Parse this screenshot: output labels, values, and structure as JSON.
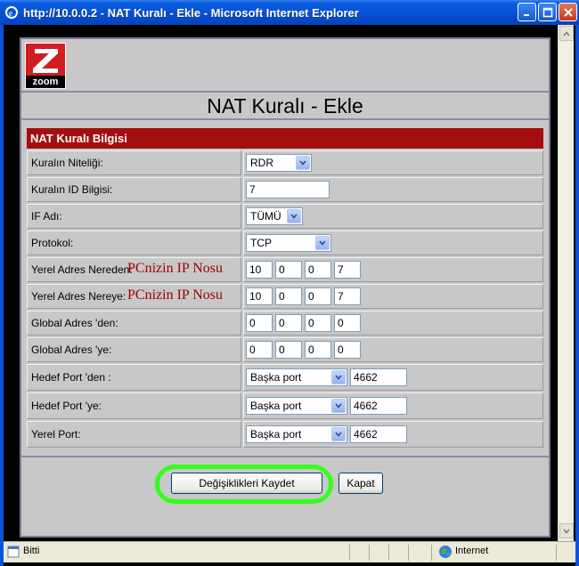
{
  "window": {
    "title": "http://10.0.0.2 - NAT Kuralı - Ekle - Microsoft Internet Explorer"
  },
  "logo": {
    "text": "zoom"
  },
  "page": {
    "title": "NAT Kuralı - Ekle",
    "section_header": "NAT Kuralı Bilgisi"
  },
  "form": {
    "rows": [
      {
        "label": "Kuralın Niteliği:",
        "control": "select",
        "value": "RDR"
      },
      {
        "label": "Kuralın ID Bilgisi:",
        "control": "text",
        "value": "7"
      },
      {
        "label": "IF Adı:",
        "control": "select",
        "value": "TÜMÜ"
      },
      {
        "label": "Protokol:",
        "control": "select",
        "value": "TCP"
      },
      {
        "label": "Yerel Adres Nereden:",
        "control": "ip",
        "values": [
          "10",
          "0",
          "0",
          "7"
        ],
        "annotation": "PCnizin IP Nosu"
      },
      {
        "label": "Yerel Adres Nereye:",
        "control": "ip",
        "values": [
          "10",
          "0",
          "0",
          "7"
        ],
        "annotation": "PCnizin IP Nosu"
      },
      {
        "label": "Global Adres 'den:",
        "control": "ip",
        "values": [
          "0",
          "0",
          "0",
          "0"
        ]
      },
      {
        "label": "Global Adres 'ye:",
        "control": "ip",
        "values": [
          "0",
          "0",
          "0",
          "0"
        ]
      },
      {
        "label": "Hedef Port 'den :",
        "control": "port",
        "select": "Başka port",
        "value": "4662"
      },
      {
        "label": "Hedef Port 'ye:",
        "control": "port",
        "select": "Başka port",
        "value": "4662"
      },
      {
        "label": "Yerel Port:",
        "control": "port",
        "select": "Başka port",
        "value": "4662"
      }
    ]
  },
  "buttons": {
    "save": "Değişiklikleri Kaydet",
    "close": "Kapat"
  },
  "statusbar": {
    "status": "Bitti",
    "zone": "Internet"
  },
  "colors": {
    "title_bar": "#0553d6",
    "section_header": "#a30f10",
    "annotation": "#a00000",
    "highlight": "#33ff1a"
  }
}
